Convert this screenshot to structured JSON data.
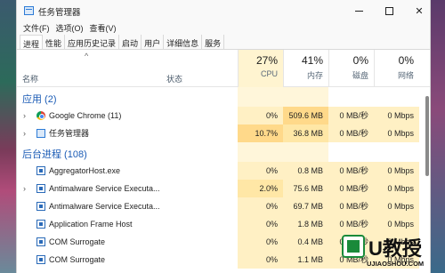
{
  "window": {
    "title": "任务管理器"
  },
  "menu": [
    "文件(F)",
    "选项(O)",
    "查看(V)"
  ],
  "tabs": [
    "进程",
    "性能",
    "应用历史记录",
    "启动",
    "用户",
    "详细信息",
    "服务"
  ],
  "header": {
    "sort_caret": "^",
    "name": "名称",
    "status": "状态",
    "cpu": {
      "pct": "27%",
      "label": "CPU"
    },
    "mem": {
      "pct": "41%",
      "label": "内存"
    },
    "disk": {
      "pct": "0%",
      "label": "磁盘"
    },
    "net": {
      "pct": "0%",
      "label": "网络"
    }
  },
  "groups": {
    "apps": {
      "title": "应用 (2)"
    },
    "background": {
      "title": "后台进程 (108)"
    }
  },
  "apps": [
    {
      "name": "Google Chrome (11)",
      "icon": "chrome-icon",
      "expandable": true,
      "cpu": "0%",
      "mem": "509.6 MB",
      "disk": "0 MB/秒",
      "net": "0 Mbps"
    },
    {
      "name": "任务管理器",
      "icon": "task-manager-icon",
      "expandable": true,
      "cpu": "10.7%",
      "mem": "36.8 MB",
      "disk": "0 MB/秒",
      "net": "0 Mbps"
    }
  ],
  "background": [
    {
      "name": "AggregatorHost.exe",
      "expandable": false,
      "cpu": "0%",
      "mem": "0.8 MB",
      "disk": "0 MB/秒",
      "net": "0 Mbps"
    },
    {
      "name": "Antimalware Service Executa...",
      "expandable": true,
      "cpu": "2.0%",
      "mem": "75.6 MB",
      "disk": "0 MB/秒",
      "net": "0 Mbps"
    },
    {
      "name": "Antimalware Service Executa...",
      "expandable": false,
      "cpu": "0%",
      "mem": "69.7 MB",
      "disk": "0 MB/秒",
      "net": "0 Mbps"
    },
    {
      "name": "Application Frame Host",
      "expandable": false,
      "cpu": "0%",
      "mem": "1.8 MB",
      "disk": "0 MB/秒",
      "net": "0 Mbps"
    },
    {
      "name": "COM Surrogate",
      "expandable": false,
      "cpu": "0%",
      "mem": "0.4 MB",
      "disk": "0 MB/秒",
      "net": "0 Mbps"
    },
    {
      "name": "COM Surrogate",
      "expandable": false,
      "cpu": "0%",
      "mem": "1.1 MB",
      "disk": "0 MB/秒",
      "net": "0 Mbps"
    }
  ],
  "watermark": {
    "text": "U教授",
    "url": "UJIAOSHOU.COM"
  },
  "colors": {
    "group_title": "#1a5bb5",
    "heat_light": "#fff4d0",
    "heat_mid": "#ffe7a6",
    "brand_green": "#1a8a3a"
  }
}
